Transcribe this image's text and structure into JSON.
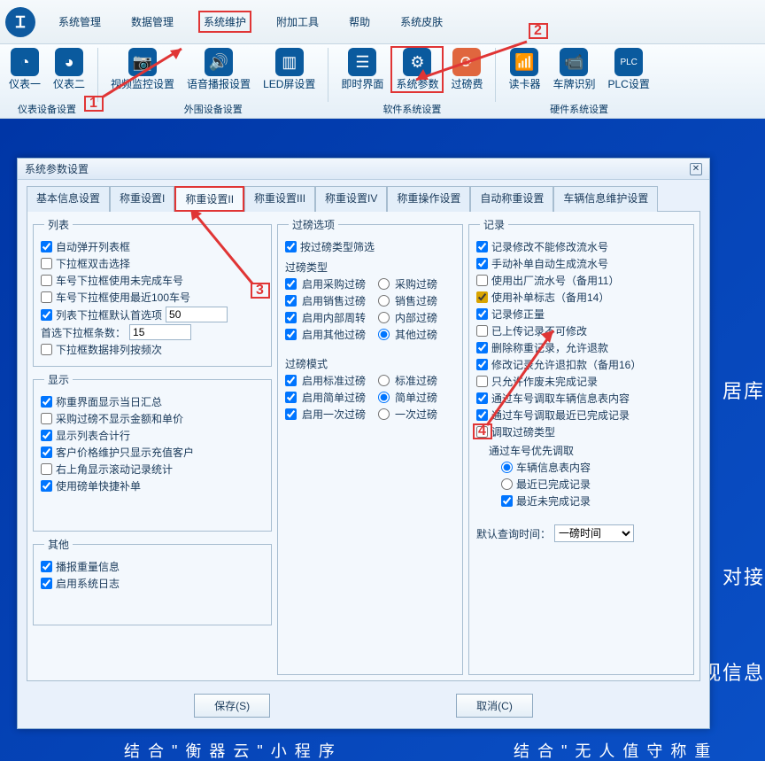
{
  "menu": {
    "items": [
      "系统管理",
      "数据管理",
      "系统维护",
      "附加工具",
      "帮助",
      "系统皮肤"
    ]
  },
  "ribbon": {
    "groups": [
      {
        "label": "仪表设备设置",
        "items": [
          {
            "label": "仪表一",
            "ic": "◔",
            "bg": "#0a5a9e"
          },
          {
            "label": "仪表二",
            "ic": "◕",
            "bg": "#0a5a9e"
          }
        ]
      },
      {
        "label": "外围设备设置",
        "items": [
          {
            "label": "视频监控设置",
            "ic": "📷",
            "bg": "#0a5a9e"
          },
          {
            "label": "语音播报设置",
            "ic": "🔊",
            "bg": "#0a5a9e"
          },
          {
            "label": "LED屏设置",
            "ic": "▥",
            "bg": "#0a5a9e"
          }
        ]
      },
      {
        "label": "软件系统设置",
        "items": [
          {
            "label": "即时界面",
            "ic": "☰",
            "bg": "#0a5a9e"
          },
          {
            "label": "系统参数",
            "ic": "⚙",
            "bg": "#0a5a9e"
          },
          {
            "label": "过磅费",
            "ic": "⟳",
            "bg": "#e0663e"
          }
        ]
      },
      {
        "label": "硬件系统设置",
        "items": [
          {
            "label": "读卡器",
            "ic": "📶",
            "bg": "#0a5a9e"
          },
          {
            "label": "车牌识别",
            "ic": "📹",
            "bg": "#0a5a9e"
          },
          {
            "label": "PLC设置",
            "ic": "PLC",
            "bg": "#0a5a9e"
          }
        ]
      }
    ]
  },
  "dialog": {
    "title": "系统参数设置",
    "tabs": [
      "基本信息设置",
      "称重设置I",
      "称重设置II",
      "称重设置III",
      "称重设置IV",
      "称重操作设置",
      "自动称重设置",
      "车辆信息维护设置"
    ],
    "listbox": {
      "legend": "列表",
      "chk": [
        {
          "t": "自动弹开列表框",
          "c": true
        },
        {
          "t": "下拉框双击选择",
          "c": false
        },
        {
          "t": "车号下拉框使用未完成车号",
          "c": false
        },
        {
          "t": "车号下拉框使用最近100车号",
          "c": false
        }
      ],
      "defItemLabel": "列表下拉框默认首选项",
      "defItemVal": "50",
      "defItemChk": true,
      "rowsLabel": "首选下拉框条数：",
      "rowsVal": "15",
      "sortChk": {
        "t": "下拉框数据排列按频次",
        "c": false
      }
    },
    "display": {
      "legend": "显示",
      "chk": [
        {
          "t": "称重界面显示当日汇总",
          "c": true
        },
        {
          "t": "采购过磅不显示金额和单价",
          "c": false
        },
        {
          "t": "显示列表合计行",
          "c": true
        },
        {
          "t": "客户价格维护只显示充值客户",
          "c": true
        },
        {
          "t": "右上角显示滚动记录统计",
          "c": false
        },
        {
          "t": "使用磅单快捷补单",
          "c": true
        }
      ]
    },
    "other": {
      "legend": "其他",
      "chk": [
        {
          "t": "播报重量信息",
          "c": true
        },
        {
          "t": "启用系统日志",
          "c": true
        }
      ]
    },
    "weighOpt": {
      "legend": "过磅选项",
      "filterChk": {
        "t": "按过磅类型筛选",
        "c": true
      },
      "typeLegend": "过磅类型",
      "types": [
        {
          "t": "启用采购过磅",
          "c": true,
          "r": "采购过磅",
          "sel": false
        },
        {
          "t": "启用销售过磅",
          "c": true,
          "r": "销售过磅",
          "sel": false
        },
        {
          "t": "启用内部周转",
          "c": true,
          "r": "内部过磅",
          "sel": false
        },
        {
          "t": "启用其他过磅",
          "c": true,
          "r": "其他过磅",
          "sel": true
        }
      ],
      "modeLegend": "过磅模式",
      "modes": [
        {
          "t": "启用标准过磅",
          "c": true,
          "r": "标准过磅",
          "sel": false
        },
        {
          "t": "启用简单过磅",
          "c": true,
          "r": "简单过磅",
          "sel": true
        },
        {
          "t": "启用一次过磅",
          "c": true,
          "r": "一次过磅",
          "sel": false
        }
      ]
    },
    "record": {
      "legend": "记录",
      "chk": [
        {
          "t": "记录修改不能修改流水号",
          "c": true,
          "y": false
        },
        {
          "t": "手动补单自动生成流水号",
          "c": true,
          "y": false
        },
        {
          "t": "使用出厂流水号（备用11）",
          "c": false,
          "y": false
        },
        {
          "t": "使用补单标志（备用14）",
          "c": true,
          "y": true
        },
        {
          "t": "记录修正量",
          "c": true,
          "y": false
        },
        {
          "t": "已上传记录不可修改",
          "c": false,
          "y": false
        },
        {
          "t": "删除称重记录，允许退款",
          "c": true,
          "y": false
        },
        {
          "t": "修改记录允许退扣款（备用16）",
          "c": true,
          "y": false
        },
        {
          "t": "只允许作废未完成记录",
          "c": false,
          "y": false
        },
        {
          "t": "通过车号调取车辆信息表内容",
          "c": true,
          "y": false
        },
        {
          "t": "通过车号调取最近已完成记录",
          "c": true,
          "y": false
        },
        {
          "t": "调取过磅类型",
          "c": false,
          "y": false
        }
      ],
      "subLegend": "通过车号优先调取",
      "radios": [
        {
          "t": "车辆信息表内容",
          "sel": true
        },
        {
          "t": "最近已完成记录",
          "sel": false
        }
      ],
      "subChk": {
        "t": "最近未完成记录",
        "c": true
      },
      "qLabel": "默认查询时间：",
      "qVal": "一磅时间"
    },
    "btns": {
      "save": "保存(S)",
      "cancel": "取消(C)"
    }
  },
  "ann": {
    "n1": "1",
    "n2": "2",
    "n3": "3",
    "n4": "4"
  },
  "bg": {
    "t1": "居库",
    "t2": "对接",
    "t3": "视信息",
    "t4": "结 合 \" 衡 器 云 \"  小 程 序",
    "t5": "结 合 \" 无 人 值 守 称 重"
  }
}
